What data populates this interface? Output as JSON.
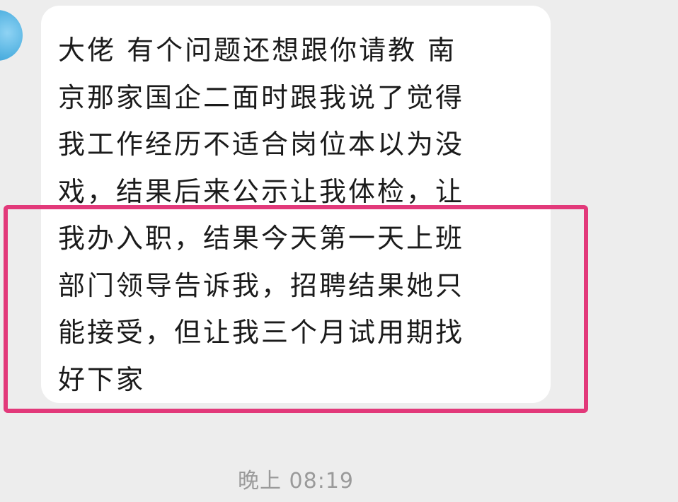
{
  "chat": {
    "message": {
      "lines": [
        "大佬 有个问题还想跟你请教  南",
        "京那家国企二面时跟我说了觉得",
        "我工作经历不适合岗位本以为没",
        "戏，结果后来公示让我体检，让",
        "我办入职，结果今天第一天上班",
        "部门领导告诉我，招聘结果她只",
        "能接受，但让我三个月试用期找",
        "好下家"
      ]
    },
    "timestamp": "晚上 08:19"
  },
  "colors": {
    "background": "#ededed",
    "bubble": "#ffffff",
    "highlight": "#e2397a",
    "timestamp": "#9a9a9a"
  }
}
